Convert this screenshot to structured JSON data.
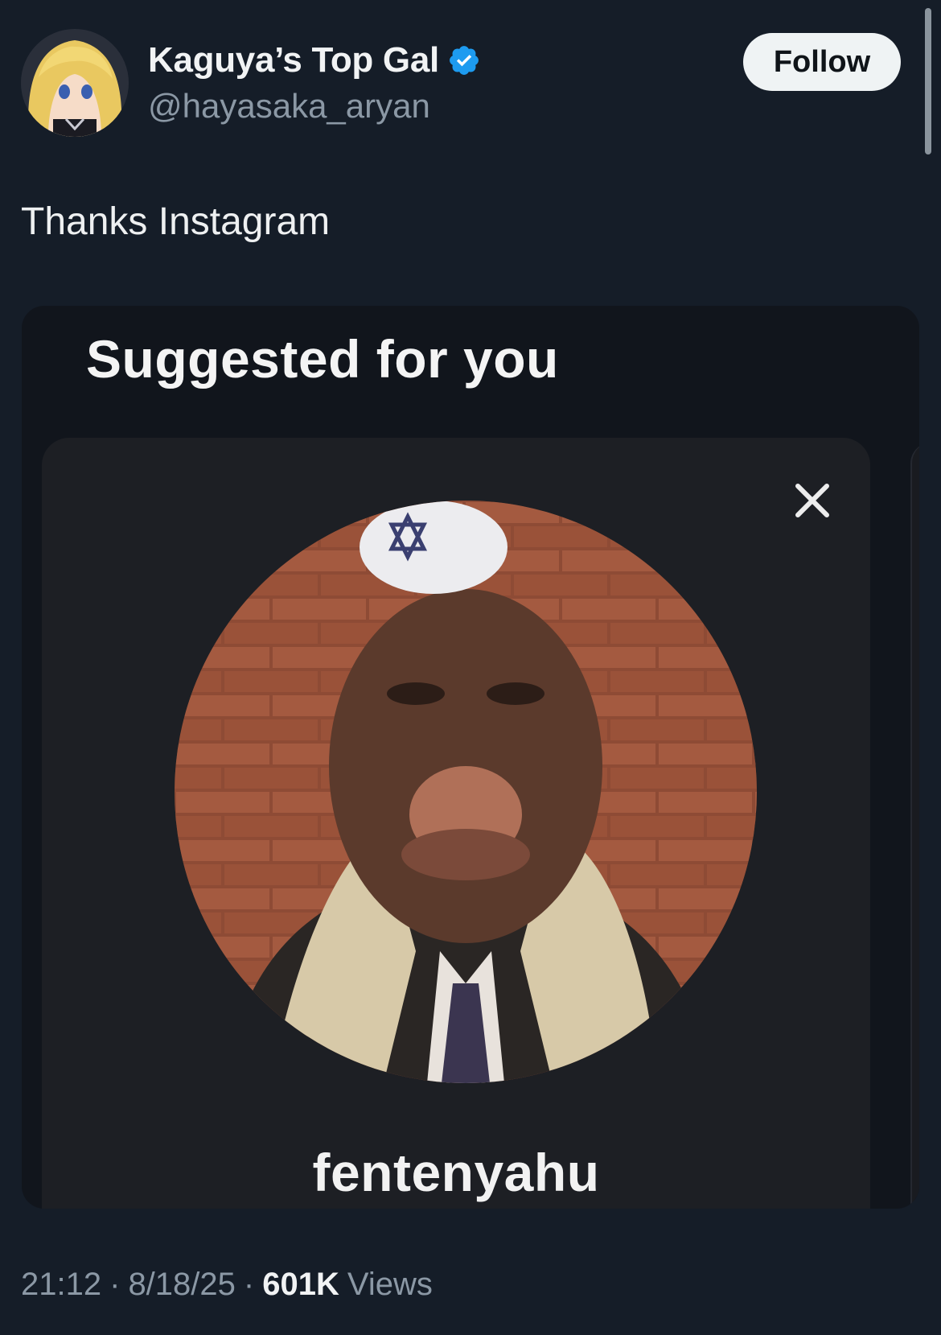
{
  "tweet": {
    "author": {
      "display_name": "Kaguya’s Top Gal",
      "handle": "@hayasaka_aryan",
      "verified": true,
      "avatar_icon": "anime-avatar"
    },
    "follow_label": "Follow",
    "text": "Thanks Instagram",
    "time": "21:12",
    "date": "8/18/25",
    "separator": "·",
    "views_count": "601K",
    "views_label": "Views"
  },
  "media": {
    "title": "Suggested for you",
    "card": {
      "username": "fentenyahu",
      "close_icon": "close-icon"
    }
  },
  "colors": {
    "background": "#151d28",
    "verified_badge": "#1d9bf0",
    "follow_button": "#eff3f4",
    "secondary_text": "#8b98a5"
  }
}
